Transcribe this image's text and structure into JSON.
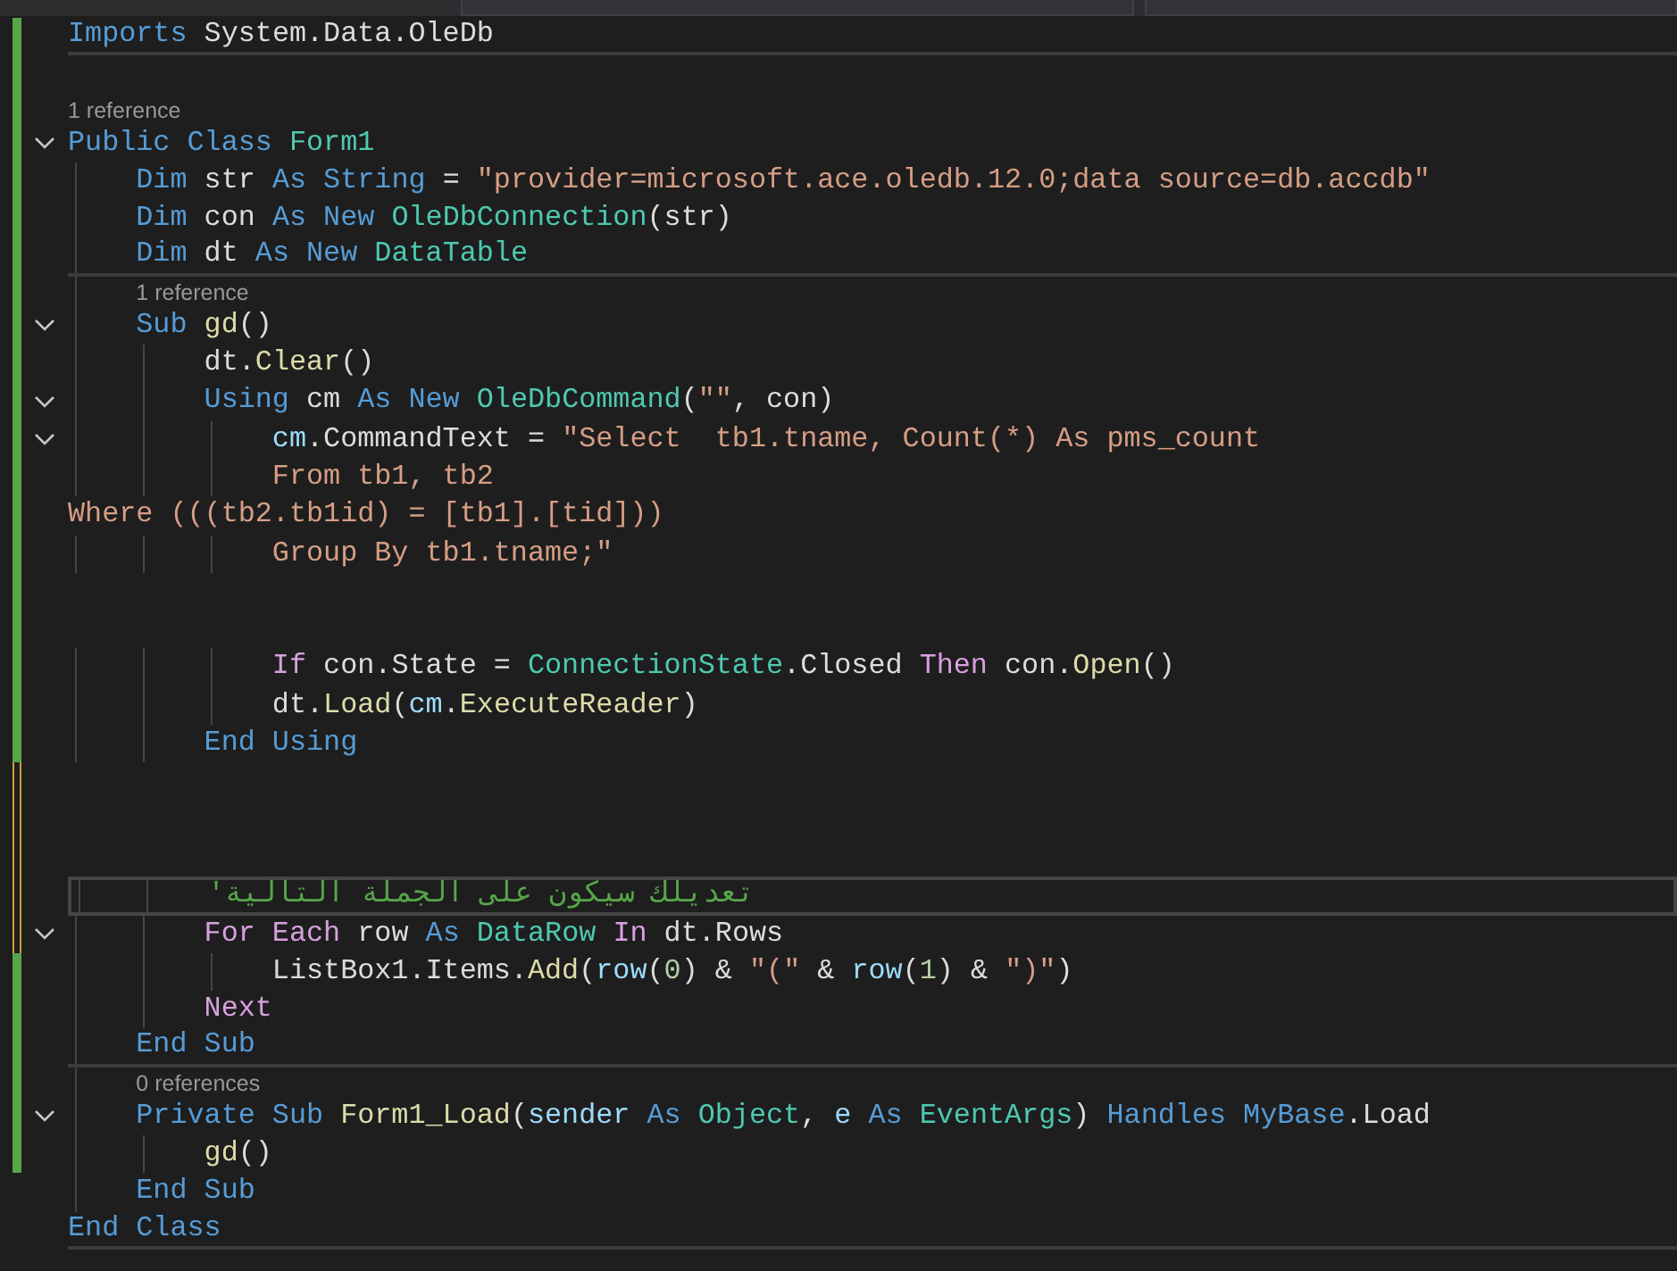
{
  "lines": [
    {
      "kind": "code",
      "edited": false,
      "separator": true,
      "tokens": [
        {
          "kind": "keyword",
          "text": "Imports"
        },
        {
          "kind": "plain",
          "text": " System.Data.OleDb"
        }
      ]
    },
    {
      "kind": "blank",
      "edited": false
    },
    {
      "kind": "codelens",
      "edited": false,
      "text": "1 reference"
    },
    {
      "kind": "code",
      "edited": false,
      "expanded": true,
      "tokens": [
        {
          "kind": "keyword",
          "text": "Public Class "
        },
        {
          "kind": "type",
          "text": "Form1"
        }
      ]
    },
    {
      "kind": "code",
      "edited": false,
      "tokens": [
        {
          "kind": "keyword",
          "text": "    Dim "
        },
        {
          "kind": "plain",
          "text": "str "
        },
        {
          "kind": "keyword",
          "text": "As String "
        },
        {
          "kind": "plain",
          "text": "= "
        },
        {
          "kind": "string",
          "text": "\"provider=microsoft.ace.oledb.12.0;data source=db.accdb\""
        }
      ]
    },
    {
      "kind": "code",
      "edited": false,
      "tokens": [
        {
          "kind": "keyword",
          "text": "    Dim "
        },
        {
          "kind": "plain",
          "text": "con "
        },
        {
          "kind": "keyword",
          "text": "As New "
        },
        {
          "kind": "type",
          "text": "OleDbConnection"
        },
        {
          "kind": "plain",
          "text": "(str)"
        }
      ]
    },
    {
      "kind": "code",
      "edited": false,
      "separator": true,
      "tokens": [
        {
          "kind": "keyword",
          "text": "    Dim "
        },
        {
          "kind": "plain",
          "text": "dt "
        },
        {
          "kind": "keyword",
          "text": "As New "
        },
        {
          "kind": "type",
          "text": "DataTable"
        }
      ]
    },
    {
      "kind": "codelens",
      "edited": false,
      "text": "    1 reference"
    },
    {
      "kind": "code",
      "edited": false,
      "expanded": true,
      "tokens": [
        {
          "kind": "keyword",
          "text": "    Sub "
        },
        {
          "kind": "method",
          "text": "gd"
        },
        {
          "kind": "plain",
          "text": "()"
        }
      ]
    },
    {
      "kind": "code",
      "edited": false,
      "tokens": [
        {
          "kind": "plain",
          "text": "        dt."
        },
        {
          "kind": "method",
          "text": "Clear"
        },
        {
          "kind": "plain",
          "text": "()"
        }
      ]
    },
    {
      "kind": "code",
      "edited": false,
      "expanded": true,
      "tokens": [
        {
          "kind": "keyword",
          "text": "        Using "
        },
        {
          "kind": "plain",
          "text": "cm "
        },
        {
          "kind": "keyword",
          "text": "As New "
        },
        {
          "kind": "type",
          "text": "OleDbCommand"
        },
        {
          "kind": "plain",
          "text": "("
        },
        {
          "kind": "string",
          "text": "\"\""
        },
        {
          "kind": "plain",
          "text": ", con)"
        }
      ]
    },
    {
      "kind": "code",
      "edited": false,
      "expanded": true,
      "tokens": [
        {
          "kind": "variable",
          "text": "            cm"
        },
        {
          "kind": "plain",
          "text": ".CommandText = "
        },
        {
          "kind": "string",
          "text": "\"Select  tb1.tname, Count(*) As pms_count"
        }
      ]
    },
    {
      "kind": "code",
      "edited": false,
      "tokens": [
        {
          "kind": "string",
          "text": "            From tb1, tb2"
        }
      ]
    },
    {
      "kind": "code",
      "edited": false,
      "tokens": [
        {
          "kind": "string",
          "text": "Where (((tb2.tb1id) = [tb1].[tid]))"
        }
      ]
    },
    {
      "kind": "code",
      "edited": false,
      "tokens": [
        {
          "kind": "string",
          "text": "            Group By tb1.tname;\""
        }
      ]
    },
    {
      "kind": "blank",
      "edited": false
    },
    {
      "kind": "blank",
      "edited": false
    },
    {
      "kind": "code",
      "edited": false,
      "tokens": [
        {
          "kind": "control",
          "text": "            If "
        },
        {
          "kind": "plain",
          "text": "con.State = "
        },
        {
          "kind": "type",
          "text": "ConnectionState"
        },
        {
          "kind": "plain",
          "text": ".Closed "
        },
        {
          "kind": "control",
          "text": "Then "
        },
        {
          "kind": "plain",
          "text": "con."
        },
        {
          "kind": "method",
          "text": "Open"
        },
        {
          "kind": "plain",
          "text": "()"
        }
      ]
    },
    {
      "kind": "code",
      "edited": false,
      "tokens": [
        {
          "kind": "plain",
          "text": "            dt."
        },
        {
          "kind": "method",
          "text": "Load"
        },
        {
          "kind": "plain",
          "text": "("
        },
        {
          "kind": "variable",
          "text": "cm"
        },
        {
          "kind": "plain",
          "text": "."
        },
        {
          "kind": "method",
          "text": "ExecuteReader"
        },
        {
          "kind": "plain",
          "text": ")"
        }
      ]
    },
    {
      "kind": "code",
      "edited": false,
      "tokens": [
        {
          "kind": "keyword",
          "text": "        End Using"
        }
      ]
    },
    {
      "kind": "blank",
      "edited": true
    },
    {
      "kind": "blank",
      "edited": true
    },
    {
      "kind": "blank",
      "edited": true
    },
    {
      "kind": "code",
      "edited": true,
      "current": true,
      "tokens": [
        {
          "kind": "comment",
          "text": "        'تعديلك سيكون على الجملة التالية"
        }
      ]
    },
    {
      "kind": "code",
      "edited": true,
      "expanded": true,
      "tokens": [
        {
          "kind": "control",
          "text": "        For Each "
        },
        {
          "kind": "plain",
          "text": "row "
        },
        {
          "kind": "keyword",
          "text": "As "
        },
        {
          "kind": "type",
          "text": "DataRow "
        },
        {
          "kind": "control",
          "text": "In "
        },
        {
          "kind": "plain",
          "text": "dt.Rows"
        }
      ]
    },
    {
      "kind": "code",
      "edited": false,
      "tokens": [
        {
          "kind": "plain",
          "text": "            ListBox1.Items."
        },
        {
          "kind": "method",
          "text": "Add"
        },
        {
          "kind": "plain",
          "text": "("
        },
        {
          "kind": "variable",
          "text": "row"
        },
        {
          "kind": "plain",
          "text": "("
        },
        {
          "kind": "number",
          "text": "0"
        },
        {
          "kind": "plain",
          "text": ") & "
        },
        {
          "kind": "string",
          "text": "\"(\""
        },
        {
          "kind": "plain",
          "text": " & "
        },
        {
          "kind": "variable",
          "text": "row"
        },
        {
          "kind": "plain",
          "text": "("
        },
        {
          "kind": "number",
          "text": "1"
        },
        {
          "kind": "plain",
          "text": ") & "
        },
        {
          "kind": "string",
          "text": "\")\""
        },
        {
          "kind": "plain",
          "text": ")"
        }
      ]
    },
    {
      "kind": "code",
      "edited": false,
      "tokens": [
        {
          "kind": "control",
          "text": "        Next"
        }
      ]
    },
    {
      "kind": "code",
      "edited": false,
      "separator": true,
      "tokens": [
        {
          "kind": "keyword",
          "text": "    End Sub"
        }
      ]
    },
    {
      "kind": "codelens",
      "edited": false,
      "text": "    0 references"
    },
    {
      "kind": "code",
      "edited": false,
      "expanded": true,
      "tokens": [
        {
          "kind": "keyword",
          "text": "    Private Sub "
        },
        {
          "kind": "method",
          "text": "Form1_Load"
        },
        {
          "kind": "plain",
          "text": "("
        },
        {
          "kind": "variable",
          "text": "sender "
        },
        {
          "kind": "keyword",
          "text": "As "
        },
        {
          "kind": "type",
          "text": "Object"
        },
        {
          "kind": "plain",
          "text": ", "
        },
        {
          "kind": "variable",
          "text": "e "
        },
        {
          "kind": "keyword",
          "text": "As "
        },
        {
          "kind": "type",
          "text": "EventArgs"
        },
        {
          "kind": "plain",
          "text": ") "
        },
        {
          "kind": "keyword",
          "text": "Handles MyBase"
        },
        {
          "kind": "plain",
          "text": ".Load"
        }
      ]
    },
    {
      "kind": "code",
      "edited": false,
      "tokens": [
        {
          "kind": "method",
          "text": "        gd"
        },
        {
          "kind": "plain",
          "text": "()"
        }
      ]
    },
    {
      "kind": "code",
      "tokens": [
        {
          "kind": "keyword",
          "text": "    End Sub"
        }
      ]
    },
    {
      "kind": "code",
      "separator": true,
      "tokens": [
        {
          "kind": "keyword",
          "text": "End Class"
        }
      ]
    }
  ]
}
